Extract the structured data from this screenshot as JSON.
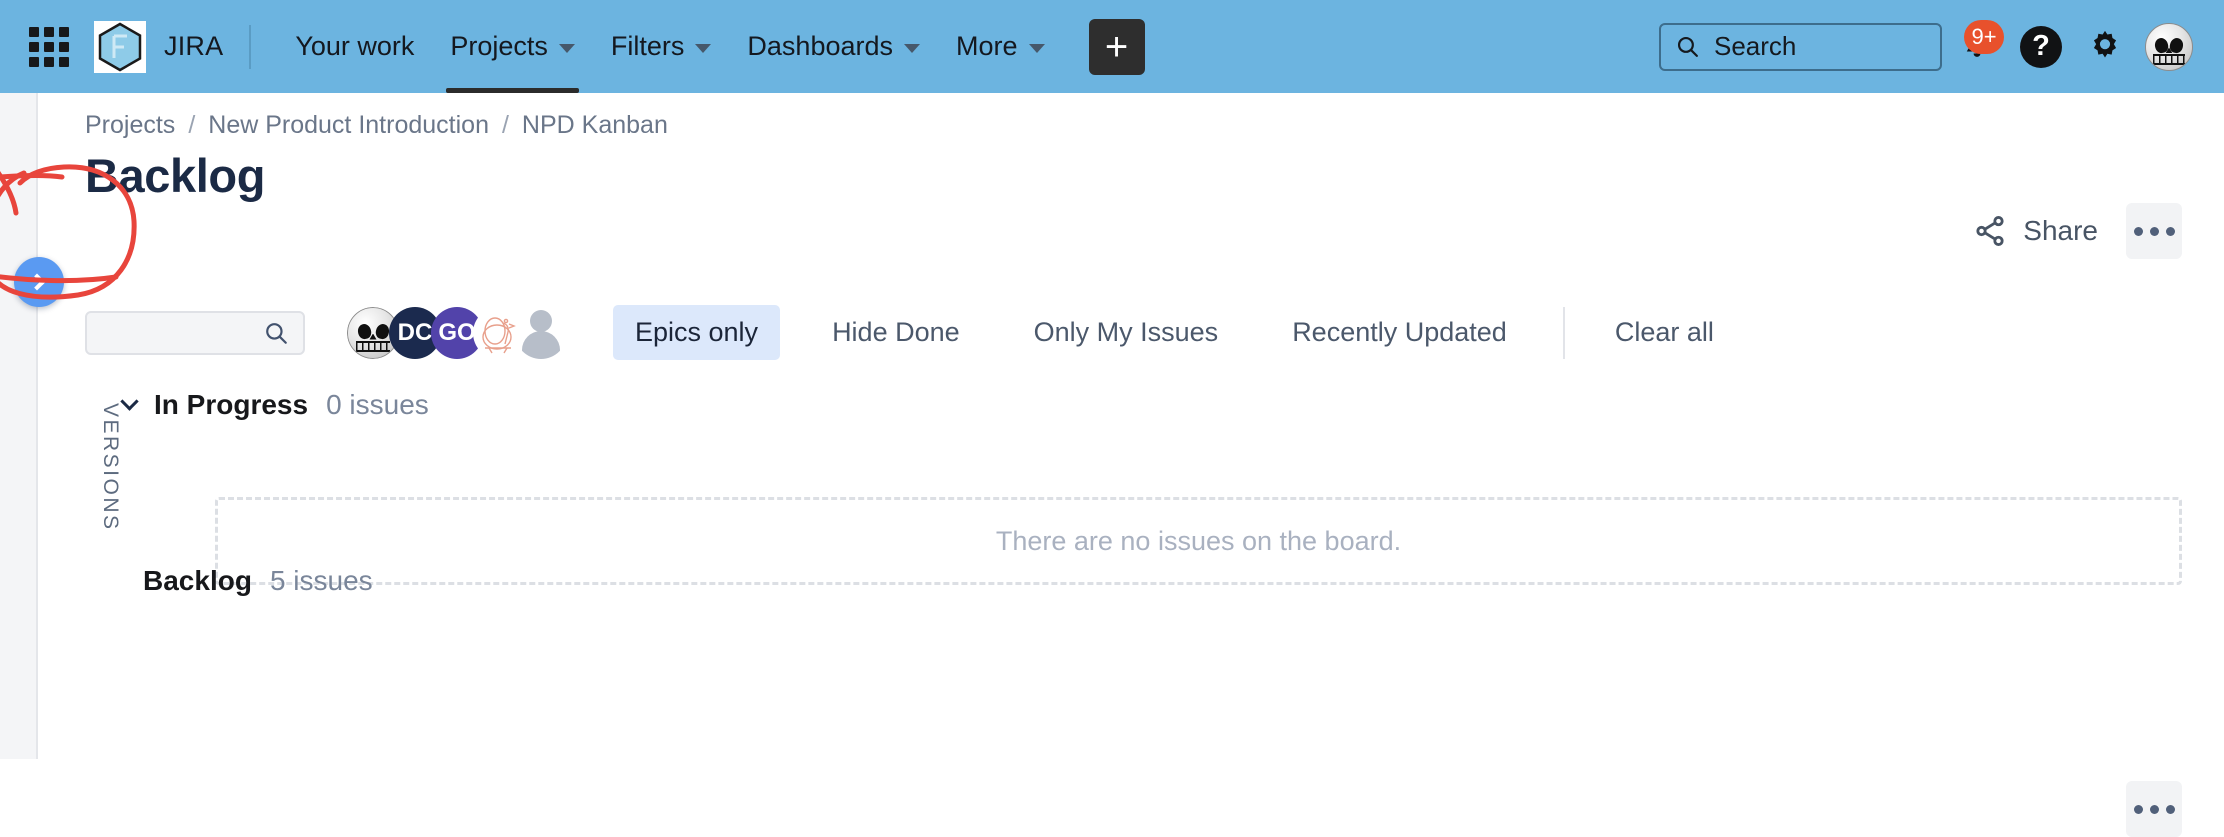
{
  "topnav": {
    "app_switcher": "app-switcher",
    "brand": "JIRA",
    "items": [
      {
        "label": "Your work",
        "has_caret": false,
        "active": false
      },
      {
        "label": "Projects",
        "has_caret": true,
        "active": true
      },
      {
        "label": "Filters",
        "has_caret": true,
        "active": false
      },
      {
        "label": "Dashboards",
        "has_caret": true,
        "active": false
      },
      {
        "label": "More",
        "has_caret": true,
        "active": false
      }
    ],
    "create_label": "+",
    "search": {
      "value": "",
      "placeholder": "Search"
    },
    "notifications_badge": "9+",
    "help_label": "?",
    "colors": {
      "header_bg": "#6cb4e0",
      "badge": "#e8512c",
      "create_bg": "#2e2e2e"
    }
  },
  "sidebar": {
    "expand_button": "expand-sidebar",
    "versions_label": "VERSIONS"
  },
  "breadcrumbs": [
    {
      "label": "Projects"
    },
    {
      "label": "New Product Introduction"
    },
    {
      "label": "NPD Kanban"
    }
  ],
  "breadcrumb_separator": "/",
  "page": {
    "title": "Backlog",
    "share_label": "Share",
    "more_label": "•••"
  },
  "filters": {
    "search": {
      "value": "",
      "placeholder": ""
    },
    "avatars": [
      {
        "name": "jack-skellington",
        "initials": "",
        "color": "#d8d8d8"
      },
      {
        "name": "dc-user",
        "initials": "DC",
        "color": "#1b2a4e"
      },
      {
        "name": "go-user",
        "initials": "GO",
        "color": "#5243aa"
      },
      {
        "name": "bird-user",
        "initials": "",
        "color": "#e8a08c"
      },
      {
        "name": "anonymous-user",
        "initials": "",
        "color": "#b7bec9"
      }
    ],
    "buttons": [
      {
        "label": "Epics only",
        "active": true
      },
      {
        "label": "Hide Done",
        "active": false
      },
      {
        "label": "Only My Issues",
        "active": false
      },
      {
        "label": "Recently Updated",
        "active": false
      }
    ],
    "clear_all_label": "Clear all",
    "active_color": "#dce8fb"
  },
  "board": {
    "in_progress": {
      "title": "In Progress",
      "count": "0 issues"
    },
    "empty_message": "There are no issues on the board.",
    "backlog": {
      "title": "Backlog",
      "count": "5 issues"
    }
  },
  "annotation": {
    "type": "hand-drawn-circle",
    "color": "#e8453c",
    "target": "expand-sidebar-button"
  }
}
